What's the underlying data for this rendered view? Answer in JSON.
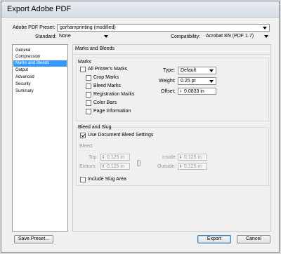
{
  "window": {
    "title": "Export Adobe PDF"
  },
  "preset": {
    "label": "Adobe PDF Preset:",
    "value": "gorhamprinting (modified)"
  },
  "standard": {
    "label": "Standard:",
    "value": "None"
  },
  "compatibility": {
    "label": "Compatibility:",
    "value": "Acrobat 8/9 (PDF 1.7)"
  },
  "sidebar": {
    "items": [
      {
        "label": "General"
      },
      {
        "label": "Compression"
      },
      {
        "label": "Marks and Bleeds"
      },
      {
        "label": "Output"
      },
      {
        "label": "Advanced"
      },
      {
        "label": "Security"
      },
      {
        "label": "Summary"
      }
    ],
    "selected": "Marks and Bleeds"
  },
  "section": {
    "title": "Marks and Bleeds"
  },
  "marks": {
    "title": "Marks",
    "all_printers": {
      "label": "All Printer's Marks",
      "checked": false
    },
    "crop": {
      "label": "Crop Marks",
      "checked": false
    },
    "bleed": {
      "label": "Bleed Marks",
      "checked": false
    },
    "registration": {
      "label": "Registration Marks",
      "checked": false
    },
    "color_bars": {
      "label": "Color Bars",
      "checked": false
    },
    "page_info": {
      "label": "Page Information",
      "checked": false
    },
    "type": {
      "label": "Type:",
      "value": "Default"
    },
    "weight": {
      "label": "Weight:",
      "value": "0.25 pt"
    },
    "offset": {
      "label": "Offset:",
      "value": "0.0833 in"
    }
  },
  "bleed_slug": {
    "title": "Bleed and Slug",
    "use_doc_bleed": {
      "label": "Use Document Bleed Settings",
      "checked": true
    },
    "bleed_label": "Bleed:",
    "top": {
      "label": "Top:",
      "value": "0.125 in"
    },
    "bottom": {
      "label": "Bottom:",
      "value": "0.125 in"
    },
    "inside": {
      "label": "Inside:",
      "value": "0.125 in"
    },
    "outside": {
      "label": "Outside:",
      "value": "0.125 in"
    },
    "include_slug": {
      "label": "Include Slug Area",
      "checked": false
    }
  },
  "buttons": {
    "save_preset": "Save Preset...",
    "export": "Export",
    "cancel": "Cancel"
  }
}
